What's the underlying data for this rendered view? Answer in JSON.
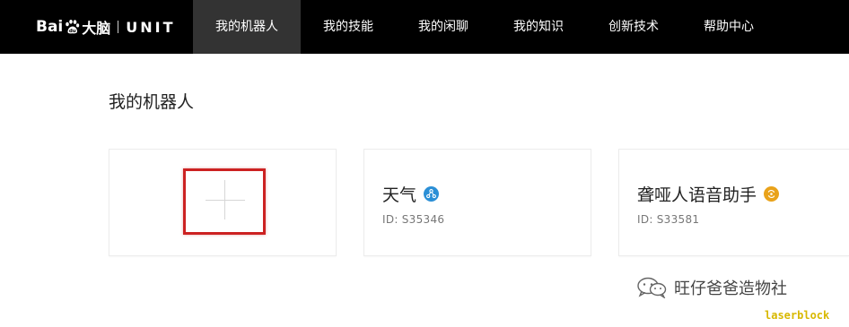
{
  "brand": {
    "baidu_text": "Bai",
    "product_text": "大脑",
    "unit_text": "UNIT",
    "colors": {
      "bar_bg": "#000000",
      "active_bg": "#333333",
      "text": "#ffffff"
    }
  },
  "nav": {
    "items": [
      {
        "label": "我的机器人",
        "active": true
      },
      {
        "label": "我的技能",
        "active": false
      },
      {
        "label": "我的闲聊",
        "active": false
      },
      {
        "label": "我的知识",
        "active": false
      },
      {
        "label": "创新技术",
        "active": false
      },
      {
        "label": "帮助中心",
        "active": false
      }
    ]
  },
  "page": {
    "title": "我的机器人"
  },
  "cards": {
    "add": {
      "icon": "plus-icon",
      "highlight_color": "#cc2222"
    },
    "items": [
      {
        "name": "天气",
        "id_label": "ID:",
        "id_value": "S35346",
        "badge_icon": "share-nodes-icon",
        "badge_color": "#2b8fd6"
      },
      {
        "name": "聋哑人语音助手",
        "id_label": "ID:",
        "id_value": "S33581",
        "badge_icon": "swirl-icon",
        "badge_color": "#e9a21a"
      }
    ]
  },
  "watermark": {
    "account": "旺仔爸爸造物社",
    "tag": "laserblock",
    "icon": "wechat-icon",
    "tag_color": "#d8b800"
  }
}
